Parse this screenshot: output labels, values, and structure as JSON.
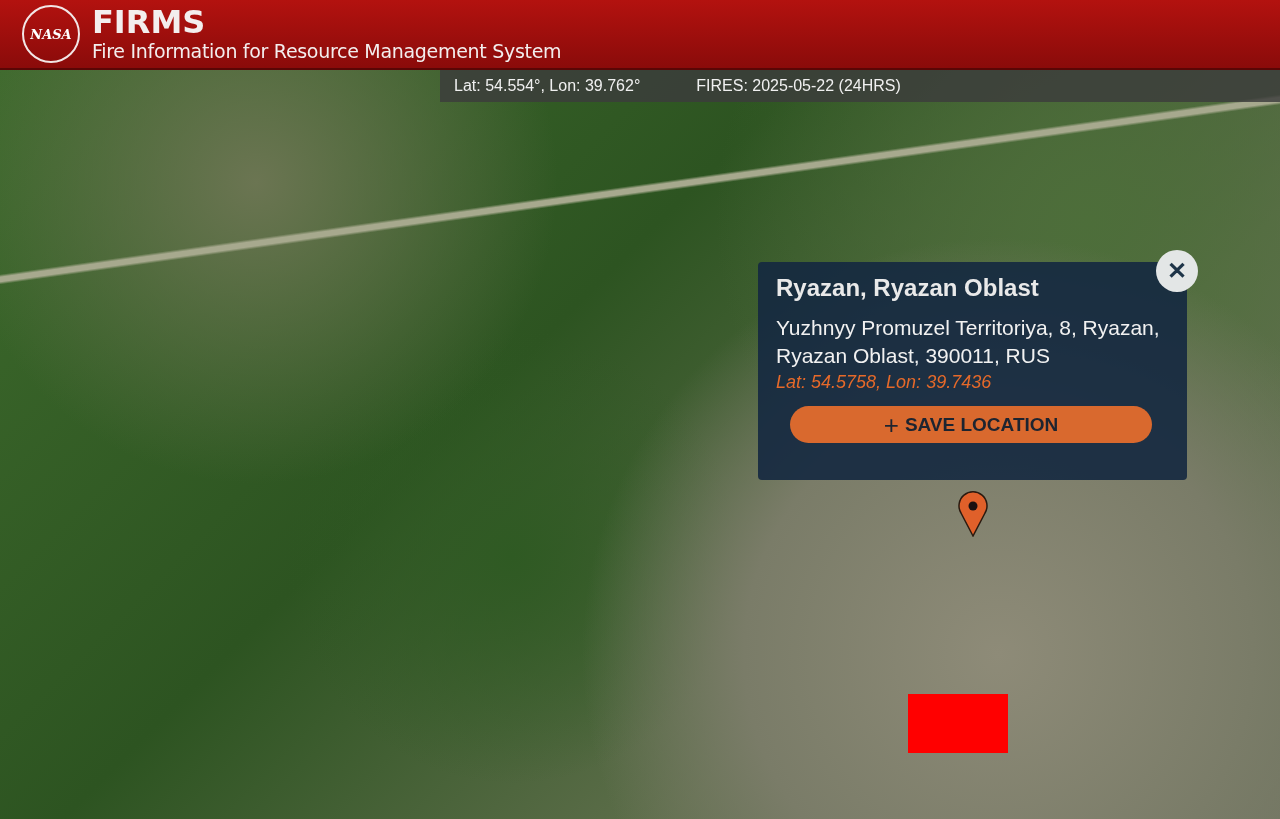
{
  "header": {
    "logo_text": "NASA",
    "title": "FIRMS",
    "subtitle": "Fire Information for Resource Management System"
  },
  "status_bar": {
    "coordinates": "Lat: 54.554°, Lon: 39.762°",
    "fires": "FIRES: 2025-05-22 (24HRS)"
  },
  "popup": {
    "title": "Ryazan, Ryazan Oblast",
    "address": "Yuzhnyy Promuzel Territoriya, 8, Ryazan, Ryazan Oblast, 390011, RUS",
    "coordinates": "Lat: 54.5758, Lon: 39.7436",
    "close": "✕",
    "button": {
      "icon": "+",
      "label": "SAVE LOCATION"
    }
  }
}
